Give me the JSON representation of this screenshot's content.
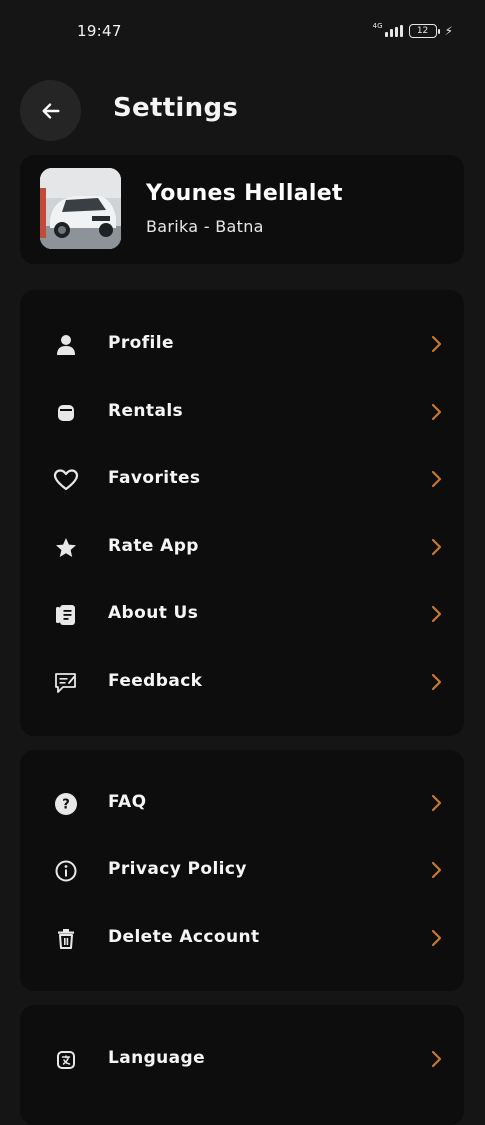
{
  "status_bar": {
    "time": "19:47",
    "network": "4G",
    "battery": "12"
  },
  "header": {
    "title": "Settings"
  },
  "profile": {
    "name": "Younes Hellalet",
    "location": "Barika - Batna"
  },
  "menu_group_1": [
    {
      "label": "Profile",
      "icon": "user-icon"
    },
    {
      "label": "Rentals",
      "icon": "rentals-icon"
    },
    {
      "label": "Favorites",
      "icon": "heart-icon"
    },
    {
      "label": "Rate App",
      "icon": "star-icon"
    },
    {
      "label": "About Us",
      "icon": "document-icon"
    },
    {
      "label": "Feedback",
      "icon": "feedback-icon"
    }
  ],
  "menu_group_2": [
    {
      "label": "FAQ",
      "icon": "question-icon"
    },
    {
      "label": "Privacy Policy",
      "icon": "info-icon"
    },
    {
      "label": "Delete Account",
      "icon": "trash-icon"
    }
  ],
  "menu_group_3": [
    {
      "label": "Language",
      "icon": "language-icon"
    }
  ],
  "colors": {
    "background": "#151515",
    "card": "#0d0d0d",
    "accent": "#c9772c",
    "text": "#f5f5f5"
  }
}
